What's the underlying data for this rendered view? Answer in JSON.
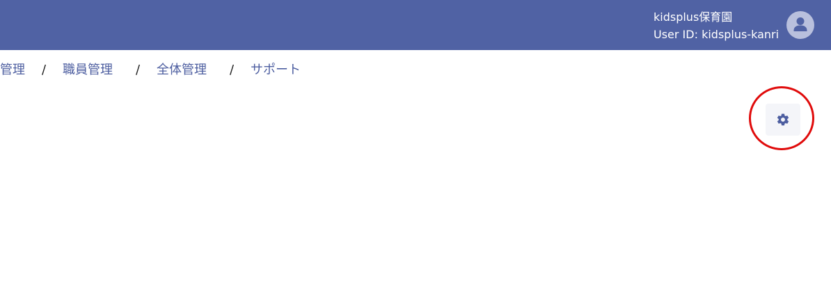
{
  "header": {
    "org_name": "kidsplus保育園",
    "user_id": "User ID: kidsplus-kanri",
    "avatar_icon": "user-avatar-icon",
    "background_color": "#5062a4"
  },
  "breadcrumb": {
    "items": [
      "管理",
      "職員管理",
      "全体管理",
      "サポート"
    ],
    "separator": "/"
  },
  "settings": {
    "icon": "gear-icon",
    "icon_color": "#4d5ea0",
    "highlight_color": "#e00b0b"
  }
}
